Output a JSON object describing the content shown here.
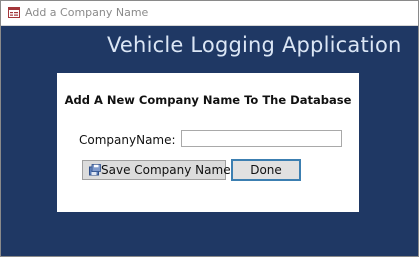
{
  "window": {
    "title": "Add a Company Name",
    "icon": "form-icon"
  },
  "header": {
    "app_title": "Vehicle Logging Application"
  },
  "form": {
    "heading": "Add A New Company Name To The Database",
    "company_name_label": "CompanyName:",
    "company_name_value": "",
    "save_button": {
      "label": "Save Company Name",
      "icon": "save-icon"
    },
    "done_button": {
      "label": "Done"
    }
  },
  "colors": {
    "background": "#1f3864",
    "app_title": "#dbe6f5",
    "panel": "#ffffff",
    "focus_border": "#3c7fb1"
  }
}
